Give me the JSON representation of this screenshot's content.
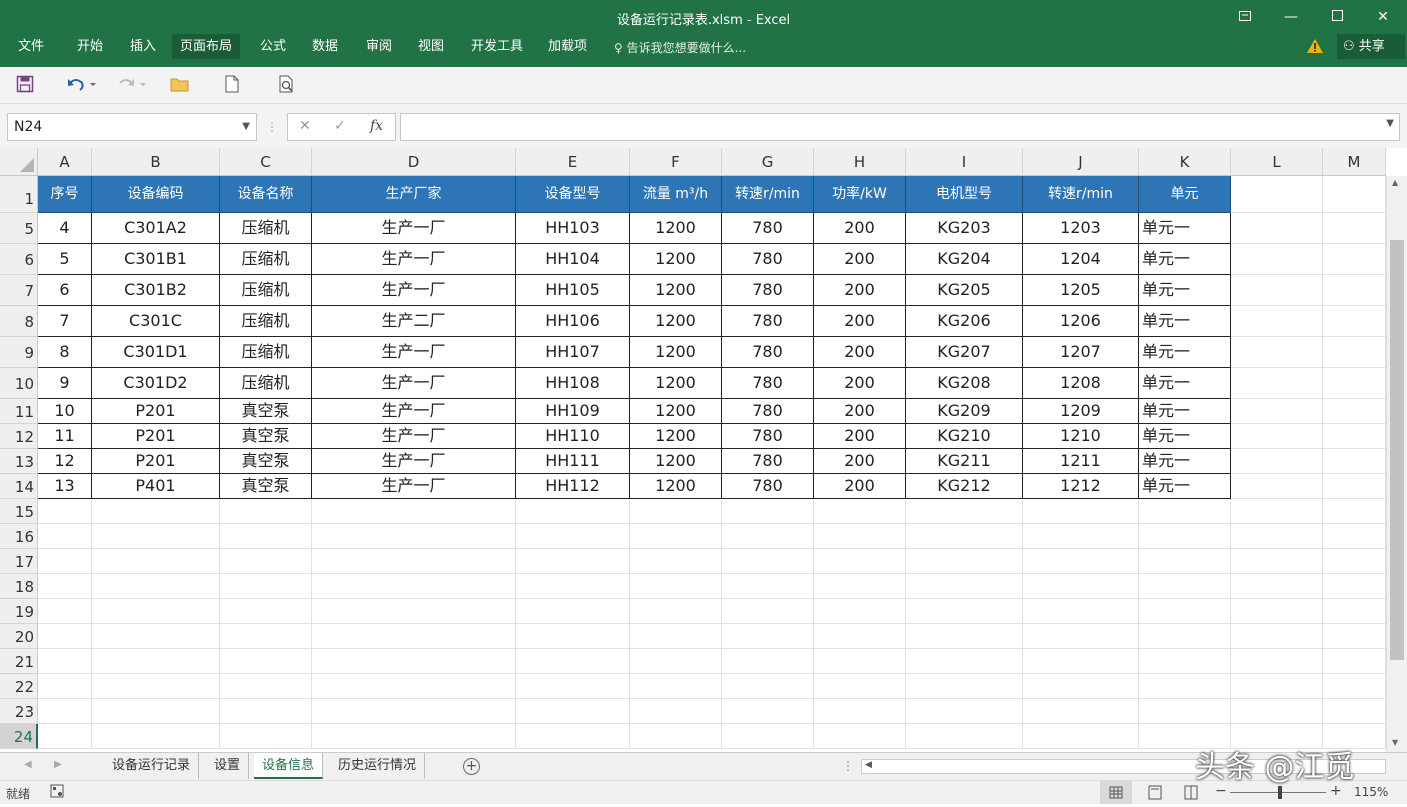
{
  "window": {
    "title": "设备运行记录表.xlsm - Excel",
    "share": "共享"
  },
  "ribbon": {
    "tabs": [
      "文件",
      "开始",
      "插入",
      "页面布局",
      "公式",
      "数据",
      "审阅",
      "视图",
      "开发工具",
      "加载项"
    ],
    "active_tab": "页面布局",
    "tell_me": "告诉我您想要做什么..."
  },
  "formula_bar": {
    "name_box": "N24",
    "fx": "fx",
    "value": ""
  },
  "columns": [
    "A",
    "B",
    "C",
    "D",
    "E",
    "F",
    "G",
    "H",
    "I",
    "J",
    "K",
    "L",
    "M"
  ],
  "rows": [
    "1",
    "5",
    "6",
    "7",
    "8",
    "9",
    "10",
    "11",
    "12",
    "13",
    "14",
    "15",
    "16",
    "17",
    "18",
    "19",
    "20",
    "21",
    "22",
    "23",
    "24"
  ],
  "table": {
    "headers": [
      "序号",
      "设备编码",
      "设备名称",
      "生产厂家",
      "设备型号",
      "流量 m³/h",
      "转速r/min",
      "功率/kW",
      "电机型号",
      "转速r/min",
      "单元"
    ],
    "data": [
      [
        "4",
        "C301A2",
        "压缩机",
        "生产一厂",
        "HH103",
        "1200",
        "780",
        "200",
        "KG203",
        "1203",
        "单元一"
      ],
      [
        "5",
        "C301B1",
        "压缩机",
        "生产一厂",
        "HH104",
        "1200",
        "780",
        "200",
        "KG204",
        "1204",
        "单元一"
      ],
      [
        "6",
        "C301B2",
        "压缩机",
        "生产一厂",
        "HH105",
        "1200",
        "780",
        "200",
        "KG205",
        "1205",
        "单元一"
      ],
      [
        "7",
        "C301C",
        "压缩机",
        "生产二厂",
        "HH106",
        "1200",
        "780",
        "200",
        "KG206",
        "1206",
        "单元一"
      ],
      [
        "8",
        "C301D1",
        "压缩机",
        "生产一厂",
        "HH107",
        "1200",
        "780",
        "200",
        "KG207",
        "1207",
        "单元一"
      ],
      [
        "9",
        "C301D2",
        "压缩机",
        "生产一厂",
        "HH108",
        "1200",
        "780",
        "200",
        "KG208",
        "1208",
        "单元一"
      ],
      [
        "10",
        "P201",
        "真空泵",
        "生产一厂",
        "HH109",
        "1200",
        "780",
        "200",
        "KG209",
        "1209",
        "单元一"
      ],
      [
        "11",
        "P201",
        "真空泵",
        "生产一厂",
        "HH110",
        "1200",
        "780",
        "200",
        "KG210",
        "1210",
        "单元一"
      ],
      [
        "12",
        "P201",
        "真空泵",
        "生产一厂",
        "HH111",
        "1200",
        "780",
        "200",
        "KG211",
        "1211",
        "单元一"
      ],
      [
        "13",
        "P401",
        "真空泵",
        "生产一厂",
        "HH112",
        "1200",
        "780",
        "200",
        "KG212",
        "1212",
        "单元一"
      ]
    ]
  },
  "sheets": [
    "设备运行记录",
    "设置",
    "设备信息",
    "历史运行情况"
  ],
  "active_sheet": "设备信息",
  "status": {
    "ready": "就绪",
    "zoom": "115%"
  },
  "watermark": "头条 @江觅",
  "colors": {
    "brand": "#217346",
    "header_fill": "#2e75b6"
  }
}
